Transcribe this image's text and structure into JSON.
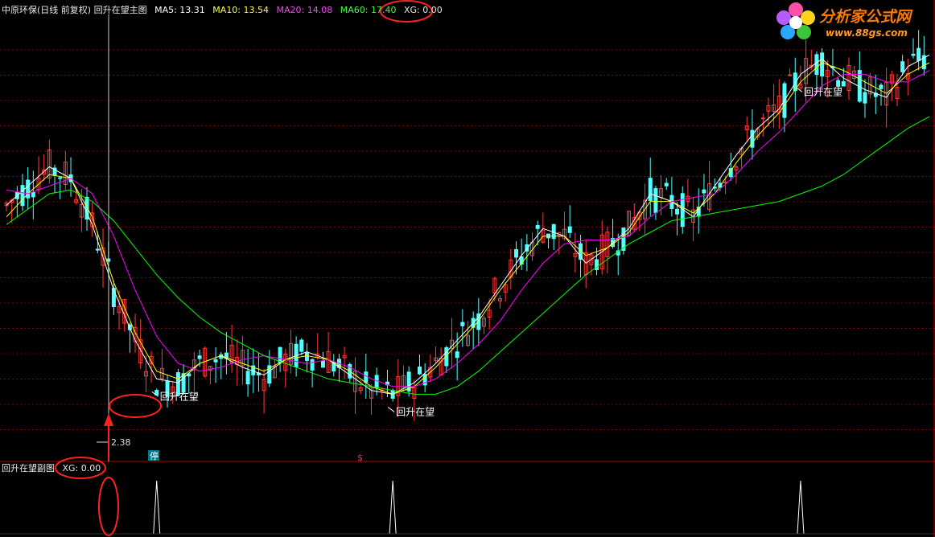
{
  "main_header": {
    "title": "中原环保(日线 前复权) 回升在望主图",
    "ma5": "MA5: 13.31",
    "ma10": "MA10: 13.54",
    "ma20": "MA20: 14.08",
    "ma60": "MA60: 17.40",
    "xg": "XG: 0.00"
  },
  "sub_header": {
    "title": "回升在望副图",
    "xg": "XG: 0.00"
  },
  "logo": {
    "text": "分析家公式网",
    "url": "www.88gs.com"
  },
  "colors": {
    "background": "#000000",
    "up_candle": "#ff3b3b",
    "down_candle": "#54ffff",
    "ma5": "#ffffff",
    "ma10": "#ffff00",
    "ma20": "#ff00ff",
    "ma60": "#00ff00",
    "grid": "#7f0000",
    "highlight": "#ff2020"
  },
  "annotations": {
    "signal_label": "回升在望",
    "low_price": "2.38",
    "ting_badge": "停",
    "s_marker": "$"
  },
  "chart_data": [
    {
      "type": "candlestick",
      "title": "回升在望主图",
      "series": [
        {
          "name": "MA5",
          "values": [
            16.9,
            17.4,
            17.9,
            17.6,
            16.4,
            14.7,
            13.4,
            12.4,
            12.3,
            12.8,
            13.0,
            12.7,
            12.5,
            12.9,
            13.1,
            12.9,
            12.5,
            12.1,
            12.0,
            12.3,
            12.8,
            13.4,
            14.0,
            14.8,
            15.6,
            16.3,
            16.1,
            15.4,
            15.8,
            16.3,
            17.2,
            17.0,
            16.6,
            17.4,
            18.2,
            18.9,
            19.4,
            20.3,
            20.7,
            20.2,
            19.9,
            19.7,
            20.5,
            20.8
          ]
        },
        {
          "name": "MA10",
          "values": [
            16.6,
            17.2,
            17.7,
            17.6,
            16.6,
            14.9,
            13.6,
            12.6,
            12.4,
            12.8,
            13.0,
            12.8,
            12.6,
            12.9,
            13.0,
            12.9,
            12.6,
            12.2,
            12.0,
            12.2,
            12.7,
            13.3,
            13.9,
            14.7,
            15.4,
            16.1,
            16.1,
            15.6,
            15.8,
            16.2,
            17.0,
            17.0,
            16.7,
            17.2,
            18.0,
            18.7,
            19.3,
            20.1,
            20.6,
            20.4,
            20.1,
            19.8,
            20.3,
            20.6
          ]
        },
        {
          "name": "MA20",
          "values": [
            17.3,
            17.2,
            17.4,
            17.6,
            17.2,
            16.1,
            14.7,
            13.5,
            12.8,
            12.6,
            12.7,
            12.9,
            13.0,
            12.9,
            12.8,
            12.9,
            12.7,
            12.4,
            12.2,
            12.2,
            12.4,
            12.8,
            13.3,
            13.9,
            14.7,
            15.4,
            15.9,
            16.0,
            16.0,
            16.1,
            16.6,
            17.0,
            17.1,
            17.2,
            17.7,
            18.3,
            18.8,
            19.4,
            20.0,
            20.3,
            20.3,
            20.1,
            20.1,
            20.4
          ]
        },
        {
          "name": "MA60",
          "values": [
            16.4,
            16.8,
            17.2,
            17.3,
            17.0,
            16.5,
            15.8,
            15.1,
            14.5,
            14.0,
            13.6,
            13.3,
            13.0,
            12.8,
            12.6,
            12.4,
            12.3,
            12.2,
            12.1,
            12.0,
            12.0,
            12.2,
            12.6,
            13.1,
            13.6,
            14.1,
            14.6,
            15.1,
            15.5,
            15.9,
            16.2,
            16.5,
            16.6,
            16.7,
            16.8,
            16.9,
            17.0,
            17.2,
            17.4,
            17.7,
            18.1,
            18.5,
            18.9,
            19.2
          ]
        }
      ],
      "ylim": [
        10.8,
        21.6
      ],
      "signals": [
        {
          "index": 7,
          "label": "回升在望"
        },
        {
          "index": 18,
          "label": "回升在望"
        },
        {
          "index": 37,
          "label": "回升在望"
        }
      ],
      "low_marker": {
        "index": 6,
        "value": "2.38"
      }
    },
    {
      "type": "line",
      "title": "回升在望副图",
      "series": [
        {
          "name": "XG",
          "values": [
            0,
            0,
            0,
            0,
            0,
            0,
            0,
            1,
            0,
            0,
            0,
            0,
            0,
            0,
            0,
            0,
            0,
            0,
            1,
            0,
            0,
            0,
            0,
            0,
            0,
            0,
            0,
            0,
            0,
            0,
            0,
            0,
            0,
            0,
            0,
            0,
            0,
            1,
            0,
            0,
            0,
            0,
            0,
            0
          ]
        }
      ],
      "ylim": [
        0,
        1
      ]
    }
  ]
}
